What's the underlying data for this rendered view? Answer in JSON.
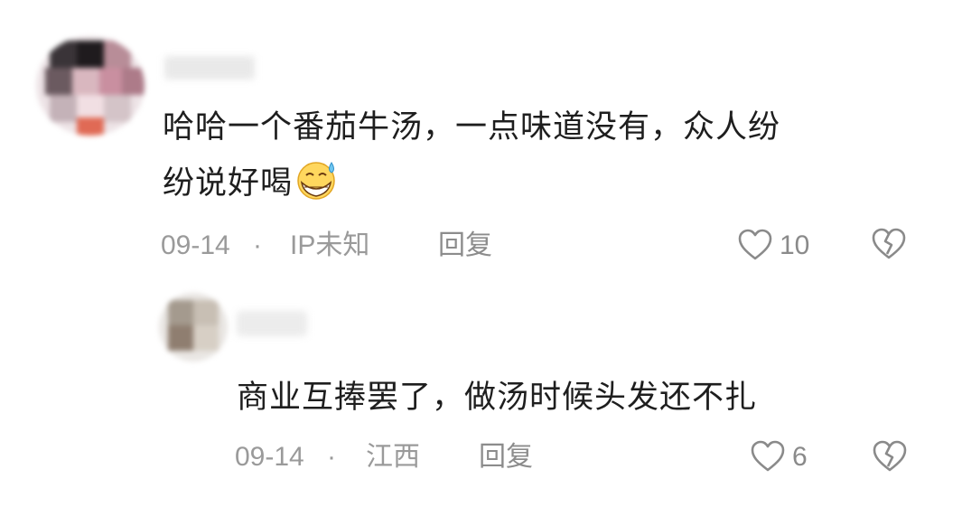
{
  "comments": [
    {
      "text_line1": "哈哈一个番茄牛汤，一点味道没有，众人纷",
      "text_line2": "纷说好喝",
      "emoji": "grinning-sweat-emoji",
      "date": "09-14",
      "separator": "·",
      "location": "IP未知",
      "reply_label": "回复",
      "likes": "10"
    },
    {
      "text": "商业互捧罢了，做汤时候头发还不扎",
      "date": "09-14",
      "separator": "·",
      "location": "江西",
      "reply_label": "回复",
      "likes": "6"
    }
  ],
  "colors": {
    "text": "#1e1e1e",
    "meta": "#9a9a9a",
    "icon": "#8a8a8a"
  }
}
